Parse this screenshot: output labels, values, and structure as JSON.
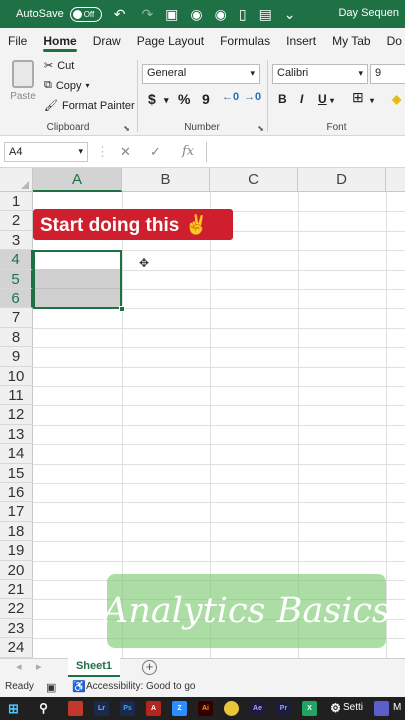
{
  "titlebar": {
    "autosave_label": "AutoSave",
    "autosave_state": "Off",
    "doc_title": "Day Sequen"
  },
  "tabs": [
    "File",
    "Home",
    "Draw",
    "Page Layout",
    "Formulas",
    "Insert",
    "My Tab",
    "Do"
  ],
  "active_tab": "Home",
  "ribbon": {
    "clipboard": {
      "paste": "Paste",
      "cut": "Cut",
      "copy": "Copy",
      "format_painter": "Format Painter",
      "label": "Clipboard"
    },
    "number": {
      "format": "General",
      "currency": "$",
      "percent": "%",
      "comma": "9",
      "label": "Number"
    },
    "font": {
      "name": "Calibri",
      "size": "9",
      "bold": "B",
      "italic": "I",
      "underline": "U",
      "label": "Font"
    }
  },
  "formula_bar": {
    "name_box": "A4",
    "cancel": "✕",
    "enter": "✓",
    "fx": "fx",
    "value": ""
  },
  "grid": {
    "columns": [
      "A",
      "B",
      "C",
      "D"
    ],
    "rows": [
      "1",
      "2",
      "3",
      "4",
      "5",
      "6",
      "7",
      "8",
      "9",
      "10",
      "11",
      "12",
      "13",
      "14",
      "15",
      "16",
      "17",
      "18",
      "19",
      "20",
      "21",
      "22",
      "23",
      "24"
    ],
    "selected_column": "A",
    "selected_rows": [
      "4",
      "5",
      "6"
    ]
  },
  "overlay": {
    "banner_text": "Start doing this ✌",
    "watermark_text": "Analytics Basics"
  },
  "sheets": {
    "tabs": [
      "Sheet1"
    ],
    "add_label": "+"
  },
  "status": {
    "ready": "Ready",
    "accessibility": "Accessibility: Good to go"
  },
  "taskbar": {
    "settings": "Setti",
    "last": "M"
  },
  "colors": {
    "excel_green": "#1e7145",
    "banner_red": "#cf1e2d",
    "watermark_green": "#78c86e"
  }
}
